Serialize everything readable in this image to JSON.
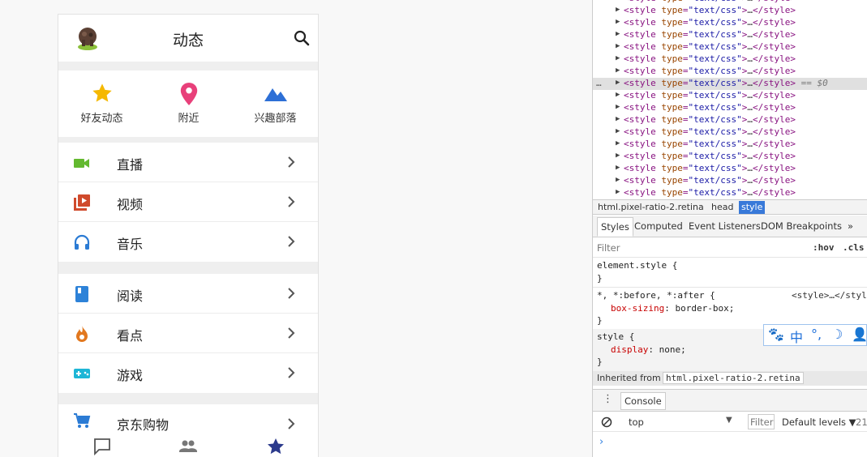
{
  "app": {
    "header_title": "动态",
    "quick_links": [
      {
        "label": "好友动态",
        "icon": "star-icon",
        "color": "#f5b800"
      },
      {
        "label": "附近",
        "icon": "location-pin-icon",
        "color": "#e8407a"
      },
      {
        "label": "兴趣部落",
        "icon": "mountain-icon",
        "color": "#2d6fd6"
      }
    ],
    "groups": [
      [
        {
          "label": "直播",
          "icon": "video-camera-icon",
          "color": "#63b92f"
        },
        {
          "label": "视频",
          "icon": "video-library-icon",
          "color": "#d04a2c"
        },
        {
          "label": "音乐",
          "icon": "headphones-icon",
          "color": "#2b7bd4"
        }
      ],
      [
        {
          "label": "阅读",
          "icon": "book-icon",
          "color": "#2d82d8"
        },
        {
          "label": "看点",
          "icon": "flame-icon",
          "color": "#e2781f"
        },
        {
          "label": "游戏",
          "icon": "gamepad-icon",
          "color": "#1eb6d6"
        }
      ],
      [
        {
          "label": "京东购物",
          "icon": "shopping-cart-icon",
          "color": "#2b7bd4"
        }
      ]
    ],
    "tabbar": [
      {
        "icon": "chat-bubble-icon",
        "color": "#555555"
      },
      {
        "icon": "people-icon",
        "color": "#777777"
      },
      {
        "icon": "star-icon",
        "color": "#2b3a8c"
      }
    ]
  },
  "devtools": {
    "dom_lines": [
      "<style type=\"text/css\">…</style>"
    ],
    "selected_suffix": "== $0",
    "breadcrumbs": [
      "html.pixel-ratio-2.retina",
      "head",
      "style"
    ],
    "panel_tabs": [
      "Styles",
      "Computed",
      "Event Listeners",
      "DOM Breakpoints",
      "»"
    ],
    "filter_placeholder": "Filter",
    "hov": ":hov",
    "cls": ".cls",
    "rules": {
      "element_style": "element.style {",
      "close": "}",
      "universal_selector": "*, *:before, *:after {",
      "universal_source": "<style>…</style",
      "box_sizing_prop": "box-sizing",
      "box_sizing_val": ": border-box;",
      "style_selector": "style {",
      "display_prop": "display",
      "display_val": ": none;"
    },
    "inherited_label": "Inherited from",
    "inherited_from": "html.pixel-ratio-2.retina",
    "console_tab": "Console",
    "context": "top",
    "console_filter": "Filter",
    "levels": "Default levels ▼",
    "count": "21",
    "ime": [
      "🐾",
      "中",
      "°,",
      "☽",
      "👤"
    ]
  }
}
